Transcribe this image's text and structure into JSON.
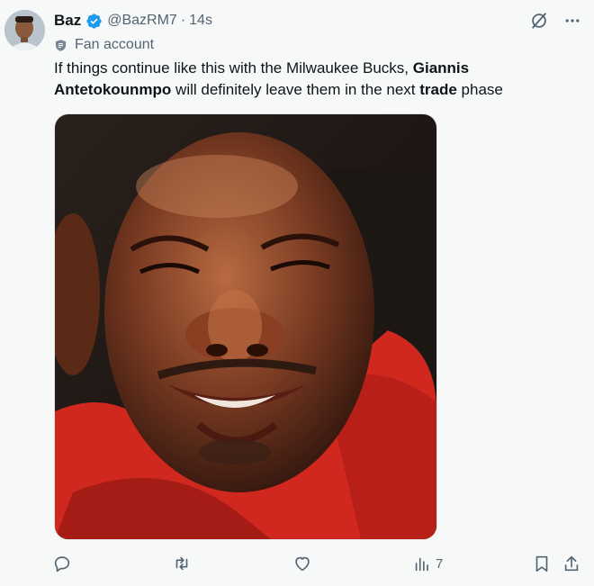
{
  "user": {
    "display_name": "Baz",
    "handle": "@BazRM7",
    "separator": "·",
    "time": "14s",
    "label": "Fan account"
  },
  "tweet": {
    "text_parts": [
      {
        "text": "If things continue like this with the Milwaukee Bucks, ",
        "bold": false
      },
      {
        "text": "Giannis Antetokounmpo",
        "bold": true
      },
      {
        "text": " will definitely leave them in the next ",
        "bold": false
      },
      {
        "text": "trade",
        "bold": true
      },
      {
        "text": " phase",
        "bold": false
      }
    ]
  },
  "actions": {
    "views": "7"
  },
  "icons": {
    "verified": "verified-badge-icon",
    "label": "shield-icon",
    "grok": "grok-icon",
    "more": "more-icon",
    "reply": "reply-icon",
    "retweet": "retweet-icon",
    "like": "heart-icon",
    "views": "views-icon",
    "bookmark": "bookmark-icon",
    "share": "share-icon"
  },
  "colors": {
    "accent": "#1d9bf0",
    "text": "#0f1419",
    "secondary": "#536471",
    "background": "#f7f9f9"
  }
}
